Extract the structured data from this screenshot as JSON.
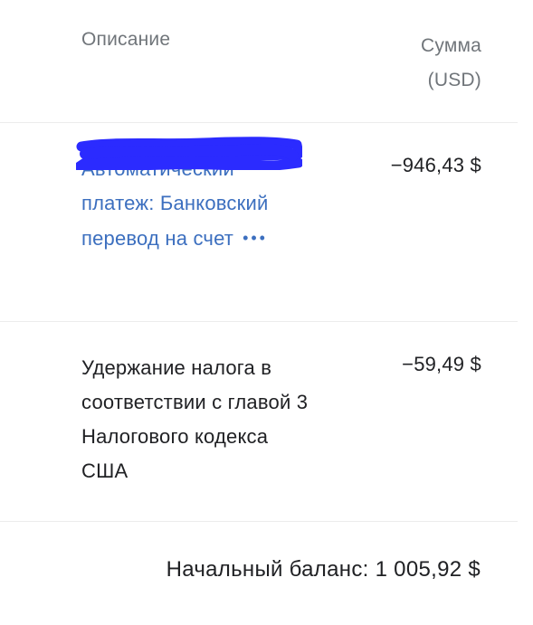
{
  "header": {
    "description_label": "Описание",
    "amount_label_line1": "Сумма",
    "amount_label_line2": "(USD)"
  },
  "transactions": [
    {
      "description_lines": [
        "Автоматический",
        "платеж: Банковский",
        "перевод на счет"
      ],
      "more_label": "•••",
      "amount": "−946,43 $",
      "is_link": true,
      "redacted": true
    },
    {
      "description_lines": [
        "Удержание налога в",
        "соответствии с главой 3",
        "Налогового кодекса",
        "США"
      ],
      "amount": "−59,49 $",
      "is_link": false
    }
  ],
  "balance": {
    "label": "Начальный баланс:",
    "value": "1 005,92 $"
  },
  "colors": {
    "link": "#3c6fbf",
    "muted": "#70757a",
    "text": "#202124",
    "redaction": "#2b2bff",
    "divider": "#ececec"
  }
}
